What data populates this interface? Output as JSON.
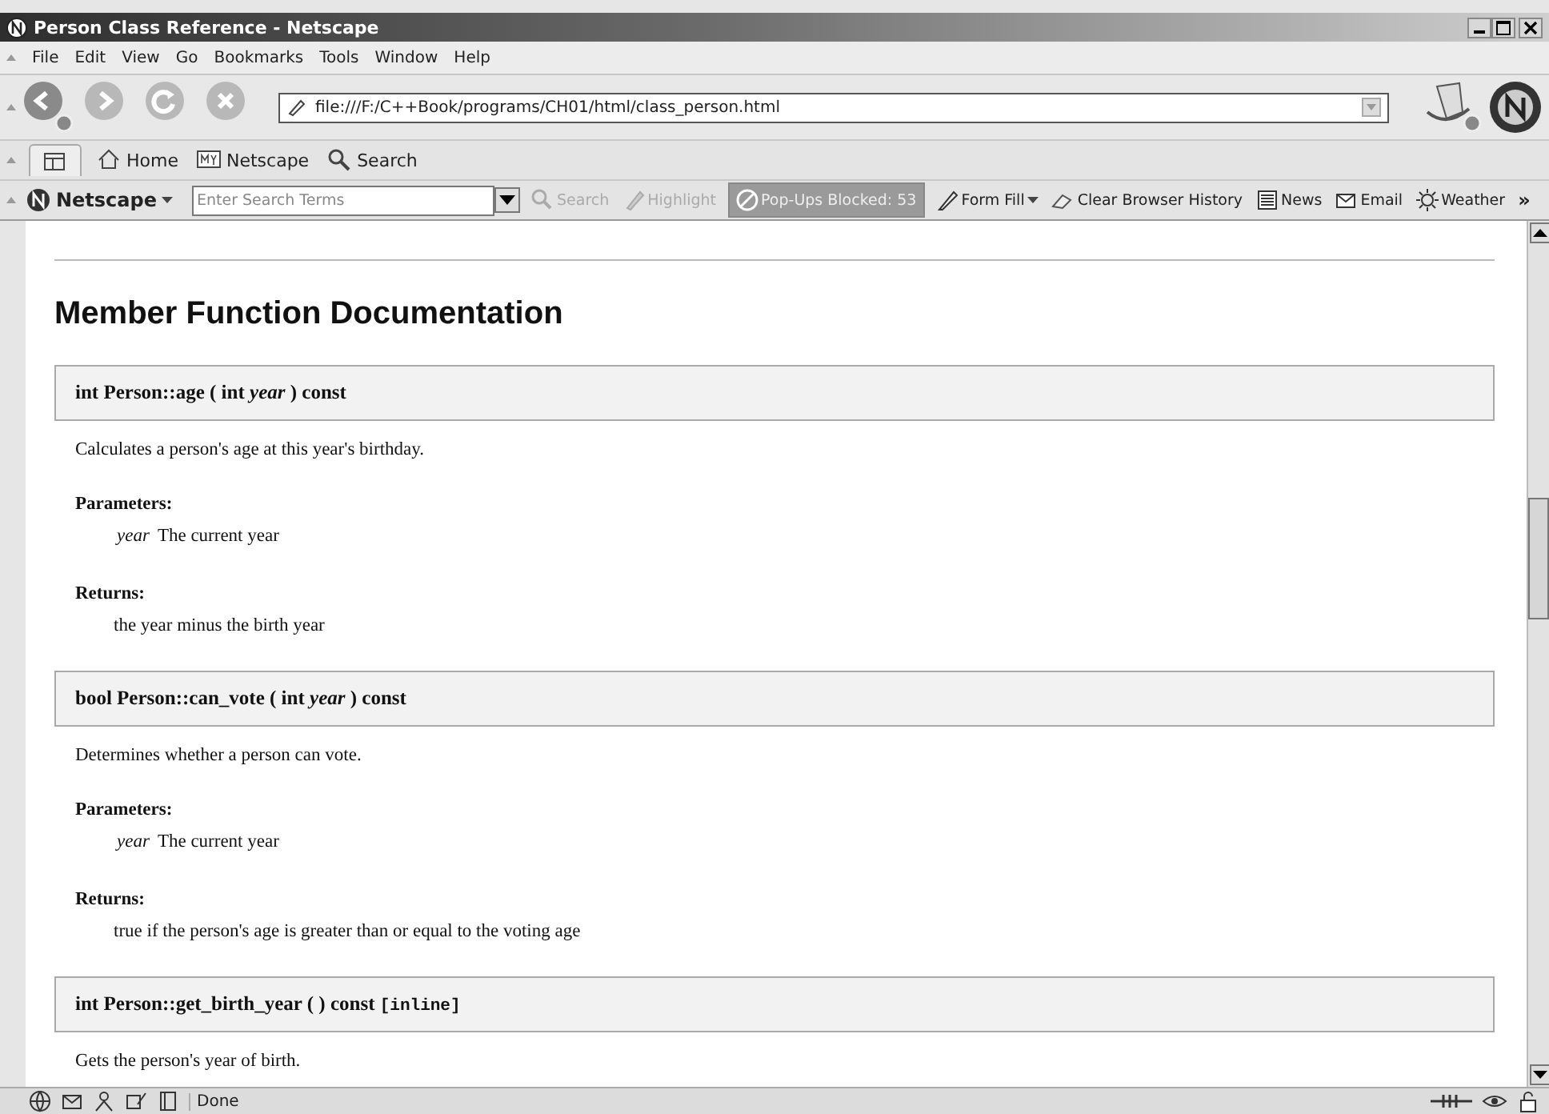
{
  "window": {
    "title": "Person Class Reference - Netscape"
  },
  "menu": [
    "File",
    "Edit",
    "View",
    "Go",
    "Bookmarks",
    "Tools",
    "Window",
    "Help"
  ],
  "address": {
    "value": "file:///F:/C++Book/programs/CH01/html/class_person.html"
  },
  "personal_toolbar": [
    {
      "kind": "tab"
    },
    {
      "kind": "home",
      "label": "Home"
    },
    {
      "kind": "my",
      "label": "Netscape"
    },
    {
      "kind": "search",
      "label": "Search"
    }
  ],
  "search_bar": {
    "brand": "Netscape",
    "placeholder": "Enter Search Terms",
    "items": [
      {
        "kind": "search",
        "label": "Search",
        "disabled": true
      },
      {
        "kind": "highlight",
        "label": "Highlight",
        "disabled": true
      },
      {
        "kind": "popup",
        "label": "Pop-Ups Blocked: 53",
        "disabled": false
      },
      {
        "kind": "formfill",
        "label": "Form Fill",
        "disabled": false
      },
      {
        "kind": "eraser",
        "label": "Clear Browser History",
        "disabled": false
      },
      {
        "kind": "news",
        "label": "News",
        "disabled": false
      },
      {
        "kind": "email",
        "label": "Email",
        "disabled": false
      },
      {
        "kind": "weather",
        "label": "Weather",
        "disabled": false
      },
      {
        "kind": "more",
        "label": "»",
        "disabled": false
      }
    ]
  },
  "page": {
    "heading": "Member Function Documentation",
    "members": [
      {
        "signature": "int Person::age ( int *year* ) const",
        "description": "Calculates a person's age at this year's birthday.",
        "parameters_label": "Parameters:",
        "parameters": [
          {
            "name": "year",
            "text": "The current year"
          }
        ],
        "returns_label": "Returns:",
        "returns": "the year minus the birth year"
      },
      {
        "signature": "bool Person::can_vote ( int *year* ) const",
        "description": "Determines whether a person can vote.",
        "parameters_label": "Parameters:",
        "parameters": [
          {
            "name": "year",
            "text": "The current year"
          }
        ],
        "returns_label": "Returns:",
        "returns": "true if the person's age is greater than or equal to the voting age"
      },
      {
        "signature": "int Person::get_birth_year (  ) const",
        "tag": "[inline]",
        "description": "Gets the person's year of birth."
      }
    ]
  },
  "status_bar": {
    "text": "Done"
  }
}
